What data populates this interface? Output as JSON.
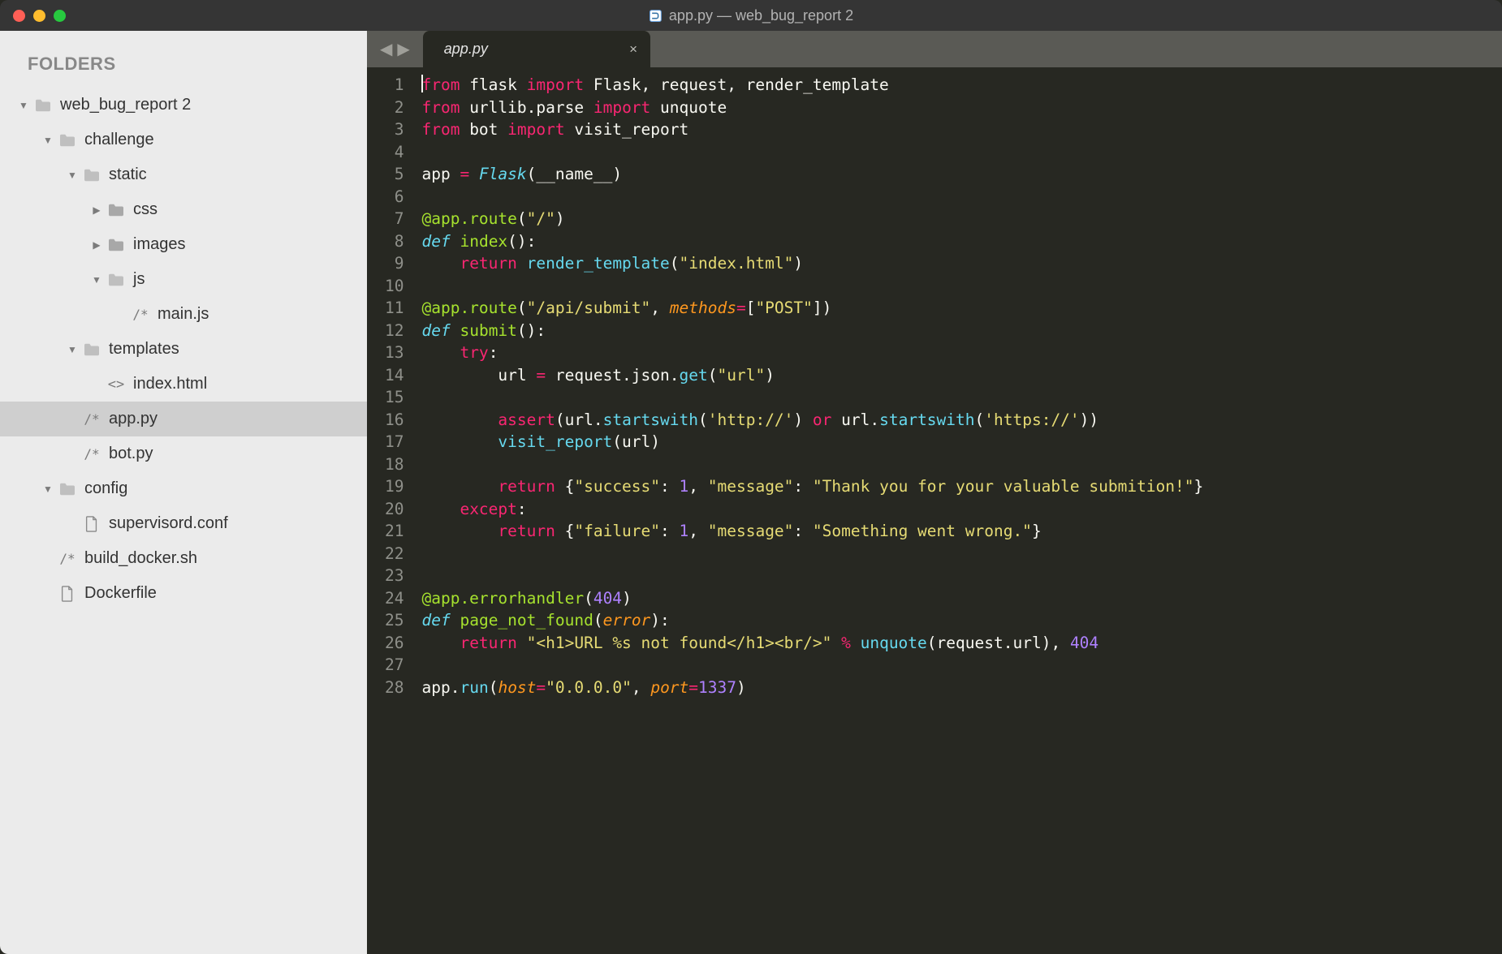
{
  "window": {
    "title": "app.py — web_bug_report 2",
    "file_icon": "python-file-icon"
  },
  "sidebar": {
    "header": "FOLDERS",
    "tree": [
      {
        "depth": 0,
        "kind": "folder",
        "open": true,
        "label": "web_bug_report 2"
      },
      {
        "depth": 1,
        "kind": "folder",
        "open": true,
        "label": "challenge"
      },
      {
        "depth": 2,
        "kind": "folder",
        "open": true,
        "label": "static"
      },
      {
        "depth": 3,
        "kind": "folder",
        "open": false,
        "label": "css"
      },
      {
        "depth": 3,
        "kind": "folder",
        "open": false,
        "label": "images"
      },
      {
        "depth": 3,
        "kind": "folder",
        "open": true,
        "label": "js"
      },
      {
        "depth": 4,
        "kind": "file",
        "icon": "code",
        "label": "main.js"
      },
      {
        "depth": 2,
        "kind": "folder",
        "open": true,
        "label": "templates"
      },
      {
        "depth": 3,
        "kind": "file",
        "icon": "html",
        "label": "index.html"
      },
      {
        "depth": 2,
        "kind": "file",
        "icon": "code",
        "label": "app.py",
        "selected": true
      },
      {
        "depth": 2,
        "kind": "file",
        "icon": "code",
        "label": "bot.py"
      },
      {
        "depth": 1,
        "kind": "folder",
        "open": true,
        "label": "config"
      },
      {
        "depth": 2,
        "kind": "file",
        "icon": "doc",
        "label": "supervisord.conf"
      },
      {
        "depth": 1,
        "kind": "file",
        "icon": "code",
        "label": "build_docker.sh"
      },
      {
        "depth": 1,
        "kind": "file",
        "icon": "doc",
        "label": "Dockerfile"
      }
    ]
  },
  "tabs": {
    "active": 0,
    "items": [
      {
        "label": "app.py",
        "dirty": false
      }
    ]
  },
  "code": {
    "filename": "app.py",
    "lines": [
      [
        {
          "c": "kw",
          "t": "from"
        },
        {
          "t": " flask "
        },
        {
          "c": "kw",
          "t": "import"
        },
        {
          "t": " Flask, request, render_template"
        }
      ],
      [
        {
          "c": "kw",
          "t": "from"
        },
        {
          "t": " urllib"
        },
        {
          "c": "punc",
          "t": "."
        },
        {
          "t": "parse "
        },
        {
          "c": "kw",
          "t": "import"
        },
        {
          "t": " unquote"
        }
      ],
      [
        {
          "c": "kw",
          "t": "from"
        },
        {
          "t": " bot "
        },
        {
          "c": "kw",
          "t": "import"
        },
        {
          "t": " visit_report"
        }
      ],
      [],
      [
        {
          "t": "app "
        },
        {
          "c": "op",
          "t": "="
        },
        {
          "t": " "
        },
        {
          "c": "cls",
          "t": "Flask"
        },
        {
          "c": "punc",
          "t": "("
        },
        {
          "t": "__name__"
        },
        {
          "c": "punc",
          "t": ")"
        }
      ],
      [],
      [
        {
          "c": "dec",
          "t": "@app.route"
        },
        {
          "c": "punc",
          "t": "("
        },
        {
          "c": "str",
          "t": "\"/\""
        },
        {
          "c": "punc",
          "t": ")"
        }
      ],
      [
        {
          "c": "kw-it",
          "t": "def"
        },
        {
          "t": " "
        },
        {
          "c": "fn",
          "t": "index"
        },
        {
          "c": "punc",
          "t": "():"
        }
      ],
      [
        {
          "t": "    "
        },
        {
          "c": "kw",
          "t": "return"
        },
        {
          "t": " "
        },
        {
          "c": "call",
          "t": "render_template"
        },
        {
          "c": "punc",
          "t": "("
        },
        {
          "c": "str",
          "t": "\"index.html\""
        },
        {
          "c": "punc",
          "t": ")"
        }
      ],
      [],
      [
        {
          "c": "dec",
          "t": "@app.route"
        },
        {
          "c": "punc",
          "t": "("
        },
        {
          "c": "str",
          "t": "\"/api/submit\""
        },
        {
          "c": "punc",
          "t": ", "
        },
        {
          "c": "arg",
          "t": "methods"
        },
        {
          "c": "op",
          "t": "="
        },
        {
          "c": "punc",
          "t": "["
        },
        {
          "c": "str",
          "t": "\"POST\""
        },
        {
          "c": "punc",
          "t": "])"
        }
      ],
      [
        {
          "c": "kw-it",
          "t": "def"
        },
        {
          "t": " "
        },
        {
          "c": "fn",
          "t": "submit"
        },
        {
          "c": "punc",
          "t": "():"
        }
      ],
      [
        {
          "t": "    "
        },
        {
          "c": "kw",
          "t": "try"
        },
        {
          "c": "punc",
          "t": ":"
        }
      ],
      [
        {
          "t": "        url "
        },
        {
          "c": "op",
          "t": "="
        },
        {
          "t": " request"
        },
        {
          "c": "punc",
          "t": "."
        },
        {
          "t": "json"
        },
        {
          "c": "punc",
          "t": "."
        },
        {
          "c": "call",
          "t": "get"
        },
        {
          "c": "punc",
          "t": "("
        },
        {
          "c": "str",
          "t": "\"url\""
        },
        {
          "c": "punc",
          "t": ")"
        }
      ],
      [],
      [
        {
          "t": "        "
        },
        {
          "c": "kw",
          "t": "assert"
        },
        {
          "c": "punc",
          "t": "("
        },
        {
          "t": "url"
        },
        {
          "c": "punc",
          "t": "."
        },
        {
          "c": "call",
          "t": "startswith"
        },
        {
          "c": "punc",
          "t": "("
        },
        {
          "c": "str",
          "t": "'http://'"
        },
        {
          "c": "punc",
          "t": ") "
        },
        {
          "c": "kw",
          "t": "or"
        },
        {
          "t": " url"
        },
        {
          "c": "punc",
          "t": "."
        },
        {
          "c": "call",
          "t": "startswith"
        },
        {
          "c": "punc",
          "t": "("
        },
        {
          "c": "str",
          "t": "'https://'"
        },
        {
          "c": "punc",
          "t": "))"
        }
      ],
      [
        {
          "t": "        "
        },
        {
          "c": "call",
          "t": "visit_report"
        },
        {
          "c": "punc",
          "t": "("
        },
        {
          "t": "url"
        },
        {
          "c": "punc",
          "t": ")"
        }
      ],
      [],
      [
        {
          "t": "        "
        },
        {
          "c": "kw",
          "t": "return"
        },
        {
          "t": " "
        },
        {
          "c": "punc",
          "t": "{"
        },
        {
          "c": "str",
          "t": "\"success\""
        },
        {
          "c": "punc",
          "t": ": "
        },
        {
          "c": "num",
          "t": "1"
        },
        {
          "c": "punc",
          "t": ", "
        },
        {
          "c": "str",
          "t": "\"message\""
        },
        {
          "c": "punc",
          "t": ": "
        },
        {
          "c": "str",
          "t": "\"Thank you for your valuable submition!\""
        },
        {
          "c": "punc",
          "t": "}"
        }
      ],
      [
        {
          "t": "    "
        },
        {
          "c": "kw",
          "t": "except"
        },
        {
          "c": "punc",
          "t": ":"
        }
      ],
      [
        {
          "t": "        "
        },
        {
          "c": "kw",
          "t": "return"
        },
        {
          "t": " "
        },
        {
          "c": "punc",
          "t": "{"
        },
        {
          "c": "str",
          "t": "\"failure\""
        },
        {
          "c": "punc",
          "t": ": "
        },
        {
          "c": "num",
          "t": "1"
        },
        {
          "c": "punc",
          "t": ", "
        },
        {
          "c": "str",
          "t": "\"message\""
        },
        {
          "c": "punc",
          "t": ": "
        },
        {
          "c": "str",
          "t": "\"Something went wrong.\""
        },
        {
          "c": "punc",
          "t": "}"
        }
      ],
      [],
      [],
      [
        {
          "c": "dec",
          "t": "@app.errorhandler"
        },
        {
          "c": "punc",
          "t": "("
        },
        {
          "c": "num",
          "t": "404"
        },
        {
          "c": "punc",
          "t": ")"
        }
      ],
      [
        {
          "c": "kw-it",
          "t": "def"
        },
        {
          "t": " "
        },
        {
          "c": "fn",
          "t": "page_not_found"
        },
        {
          "c": "punc",
          "t": "("
        },
        {
          "c": "arg",
          "t": "error"
        },
        {
          "c": "punc",
          "t": "):"
        }
      ],
      [
        {
          "t": "    "
        },
        {
          "c": "kw",
          "t": "return"
        },
        {
          "t": " "
        },
        {
          "c": "str",
          "t": "\"<h1>URL %s not found</h1><br/>\""
        },
        {
          "t": " "
        },
        {
          "c": "op",
          "t": "%"
        },
        {
          "t": " "
        },
        {
          "c": "call",
          "t": "unquote"
        },
        {
          "c": "punc",
          "t": "("
        },
        {
          "t": "request"
        },
        {
          "c": "punc",
          "t": "."
        },
        {
          "t": "url"
        },
        {
          "c": "punc",
          "t": "), "
        },
        {
          "c": "num",
          "t": "404"
        }
      ],
      [],
      [
        {
          "t": "app"
        },
        {
          "c": "punc",
          "t": "."
        },
        {
          "c": "call",
          "t": "run"
        },
        {
          "c": "punc",
          "t": "("
        },
        {
          "c": "arg",
          "t": "host"
        },
        {
          "c": "op",
          "t": "="
        },
        {
          "c": "str",
          "t": "\"0.0.0.0\""
        },
        {
          "c": "punc",
          "t": ", "
        },
        {
          "c": "arg",
          "t": "port"
        },
        {
          "c": "op",
          "t": "="
        },
        {
          "c": "num",
          "t": "1337"
        },
        {
          "c": "punc",
          "t": ")"
        }
      ]
    ]
  }
}
